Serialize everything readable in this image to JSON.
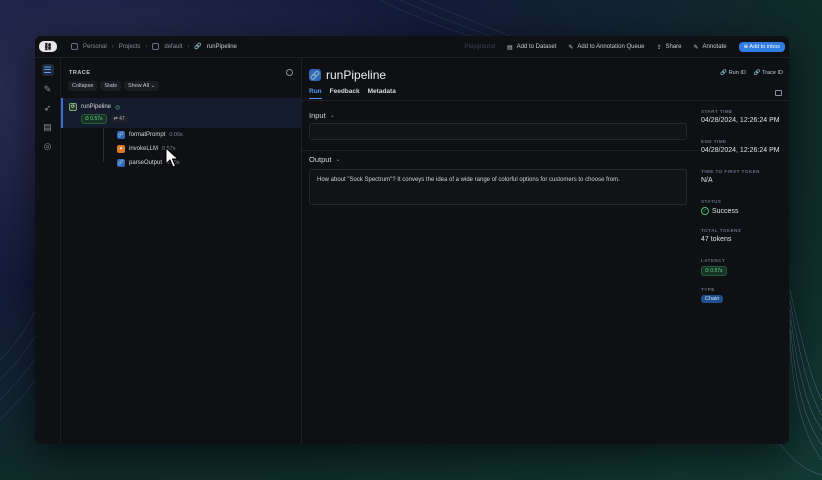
{
  "topbar": {
    "breadcrumbs": [
      "Personal",
      "Projects",
      "default",
      "runPipeline"
    ],
    "actions": {
      "ghost": "Playground",
      "add_to_dataset": "Add to Dataset",
      "add_to_queue": "Add to Annotation Queue",
      "share": "Share",
      "annotate": "Annotate",
      "add_to_inbox": "Add to inbox"
    }
  },
  "trace": {
    "title": "TRACE",
    "buttons": {
      "collapse": "Collapse",
      "stats": "Stats",
      "show_all": "Show All"
    },
    "root": {
      "name": "runPipeline",
      "latency": "0.57s",
      "tokens": "47"
    },
    "children": [
      {
        "name": "formatPrompt",
        "latency": "0.00s"
      },
      {
        "name": "invokeLLM",
        "latency": "0.57s"
      },
      {
        "name": "parseOutput",
        "latency": "0.00s"
      }
    ]
  },
  "main": {
    "title": "runPipeline",
    "tabs": [
      "Run",
      "Feedback",
      "Metadata"
    ],
    "input_label": "Input",
    "output_label": "Output",
    "output_text": "How about \"Sock Spectrum\"? It conveys the idea of a wide range of colorful options for customers to choose from."
  },
  "meta": {
    "run_id": "Run ID",
    "trace_id": "Trace ID",
    "start_time_label": "START TIME",
    "start_time": "04/28/2024, 12:26:24 PM",
    "end_time_label": "END TIME",
    "end_time": "04/28/2024, 12:26:24 PM",
    "ttft_label": "TIME TO FIRST TOKEN",
    "ttft": "N/A",
    "status_label": "STATUS",
    "status": "Success",
    "tokens_label": "TOTAL TOKENS",
    "tokens": "47 tokens",
    "latency_label": "LATENCY",
    "latency": "0.57s",
    "type_label": "TYPE",
    "type": "Chain"
  },
  "colors": {
    "accent": "#5b9bf0",
    "success": "#4fbf70",
    "llm": "#d97a2b"
  }
}
